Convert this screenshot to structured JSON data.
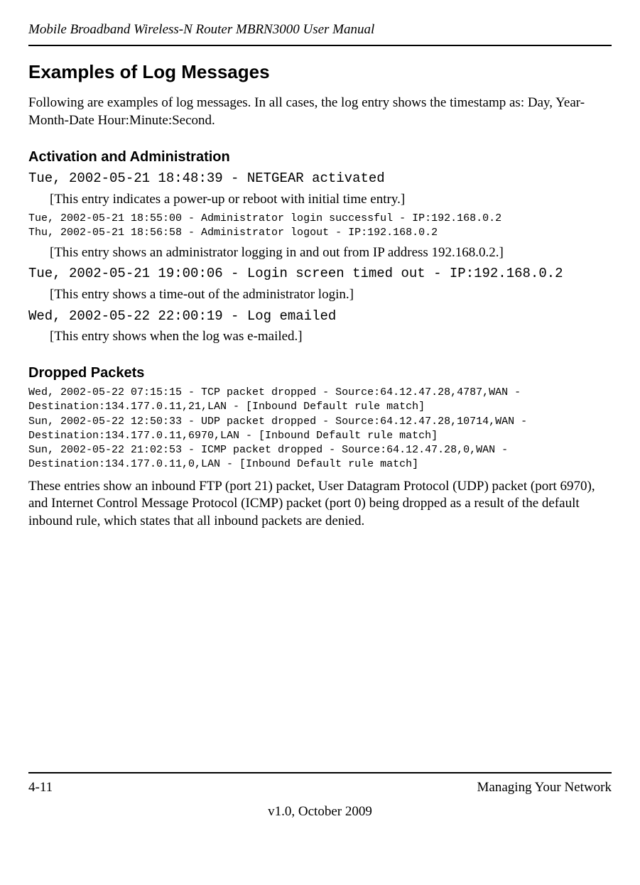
{
  "header": {
    "title": "Mobile Broadband Wireless-N Router MBRN3000 User Manual"
  },
  "section": {
    "heading": "Examples of Log Messages",
    "intro": "Following are examples of log messages. In all cases, the log entry shows the timestamp as: Day, Year-Month-Date  Hour:Minute:Second."
  },
  "activation": {
    "heading": "Activation and Administration",
    "log1": "Tue, 2002-05-21 18:48:39 - NETGEAR activated",
    "note1": "[This entry indicates a power-up or reboot with initial time entry.]",
    "log2": "Tue, 2002-05-21 18:55:00 - Administrator login successful - IP:192.168.0.2\nThu, 2002-05-21 18:56:58 - Administrator logout - IP:192.168.0.2",
    "note2": "[This entry shows an administrator logging in and out from IP address 192.168.0.2.]",
    "log3": "Tue, 2002-05-21 19:00:06 - Login screen timed out - IP:192.168.0.2",
    "note3": "[This entry shows a time-out of the administrator login.]",
    "log4": "Wed, 2002-05-22 22:00:19 - Log emailed",
    "note4": "[This entry shows when the log was e-mailed.]"
  },
  "dropped": {
    "heading": "Dropped Packets",
    "logs": "Wed, 2002-05-22 07:15:15 - TCP packet dropped - Source:64.12.47.28,4787,WAN - Destination:134.177.0.11,21,LAN - [Inbound Default rule match]\nSun, 2002-05-22 12:50:33 - UDP packet dropped - Source:64.12.47.28,10714,WAN - Destination:134.177.0.11,6970,LAN - [Inbound Default rule match]\nSun, 2002-05-22 21:02:53 - ICMP packet dropped - Source:64.12.47.28,0,WAN - Destination:134.177.0.11,0,LAN - [Inbound Default rule match]",
    "explanation": "These entries show an inbound FTP (port 21) packet, User Datagram Protocol (UDP) packet (port 6970), and Internet Control Message Protocol (ICMP) packet (port 0) being dropped as a result of the default inbound rule, which states that all inbound packets are denied."
  },
  "footer": {
    "page": "4-11",
    "section": "Managing Your Network",
    "version": "v1.0, October 2009"
  }
}
